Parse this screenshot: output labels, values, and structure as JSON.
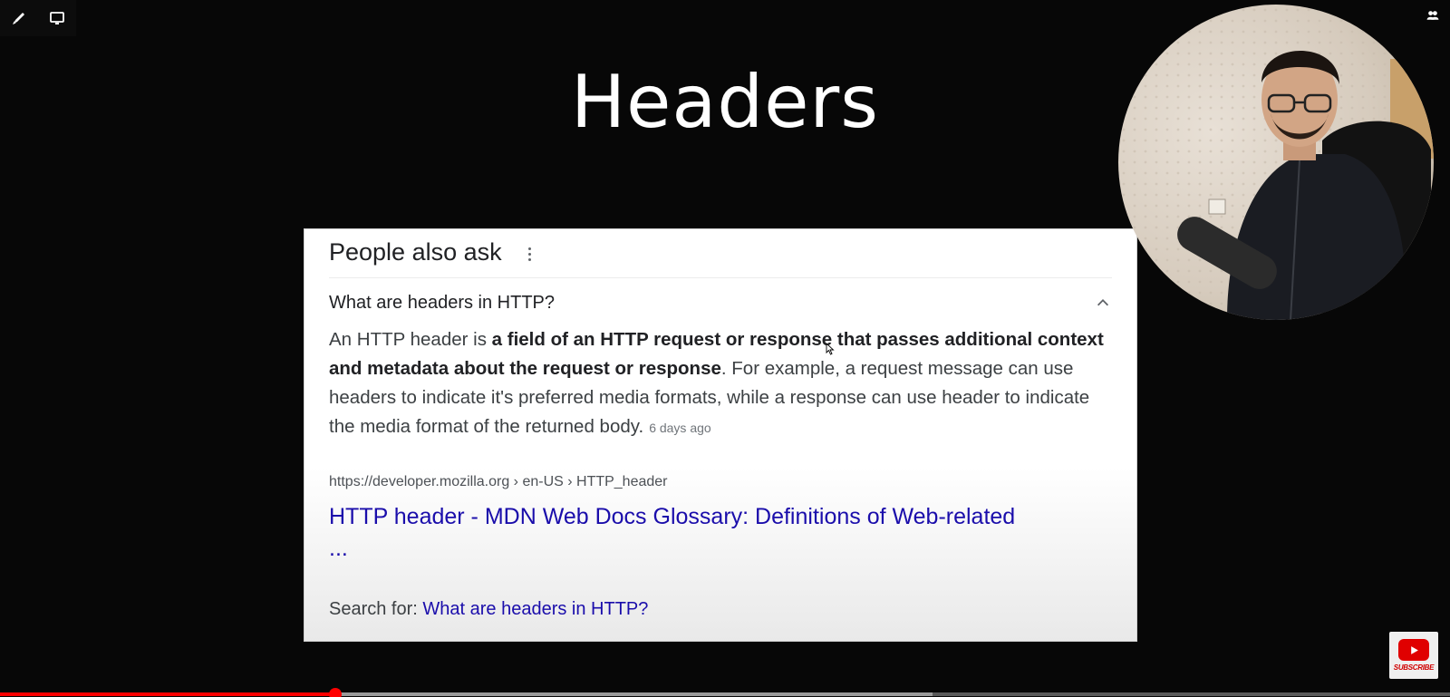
{
  "toolbar": {
    "items": [
      {
        "name": "pen-icon"
      },
      {
        "name": "screen-icon"
      }
    ]
  },
  "corner_icon": "people-icon",
  "slide": {
    "title": "Headers"
  },
  "paa": {
    "heading": "People also ask",
    "question": "What are headers in HTTP?",
    "answer": {
      "lead": "An HTTP header is ",
      "bold": "a field of an HTTP request or response that passes additional context and metadata about the request or response",
      "rest": ". For example, a request message can use headers to indicate it's preferred media formats, while a response can use header to indicate the media format of the returned body.",
      "age": "6 days ago"
    },
    "source_url": "https://developer.mozilla.org › en-US › HTTP_header",
    "result_title": "HTTP header - MDN Web Docs Glossary: Definitions of Web-related ...",
    "search_for_label": "Search for: ",
    "search_for_query": "What are headers in HTTP?"
  },
  "subscribe": {
    "label": "SUBSCRIBE"
  },
  "video": {
    "played_fraction": 0.231,
    "loaded_fraction": 0.643
  },
  "colors": {
    "background": "#070707",
    "link": "#1a0dab",
    "progress": "#ff0000"
  }
}
